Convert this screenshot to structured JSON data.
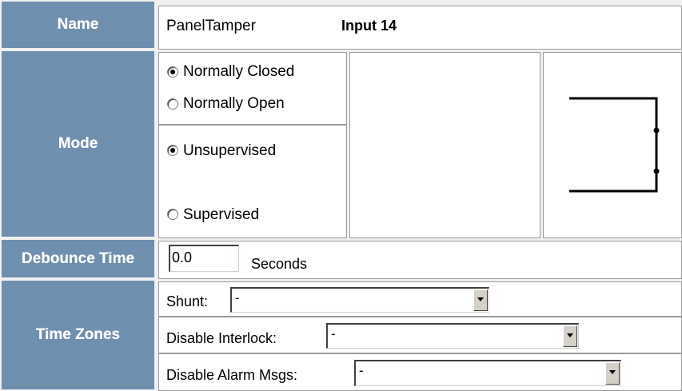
{
  "name_row": {
    "label": "Name",
    "value": "PanelTamper",
    "input_id": "Input 14"
  },
  "mode_row": {
    "label": "Mode",
    "contact": [
      {
        "label": "Normally Closed",
        "checked": true
      },
      {
        "label": "Normally Open",
        "checked": false
      }
    ],
    "supervision": [
      {
        "label": "Unsupervised",
        "checked": true
      },
      {
        "label": "Supervised",
        "checked": false
      }
    ]
  },
  "debounce_row": {
    "label": "Debounce Time",
    "value": "0.0",
    "unit": "Seconds"
  },
  "timezones_row": {
    "label": "Time Zones",
    "shunt": {
      "label": "Shunt:",
      "value": "-"
    },
    "disable_interlock": {
      "label": "Disable Interlock:",
      "value": "-"
    },
    "disable_alarm_msgs": {
      "label": "Disable Alarm Msgs:",
      "value": "-"
    }
  }
}
